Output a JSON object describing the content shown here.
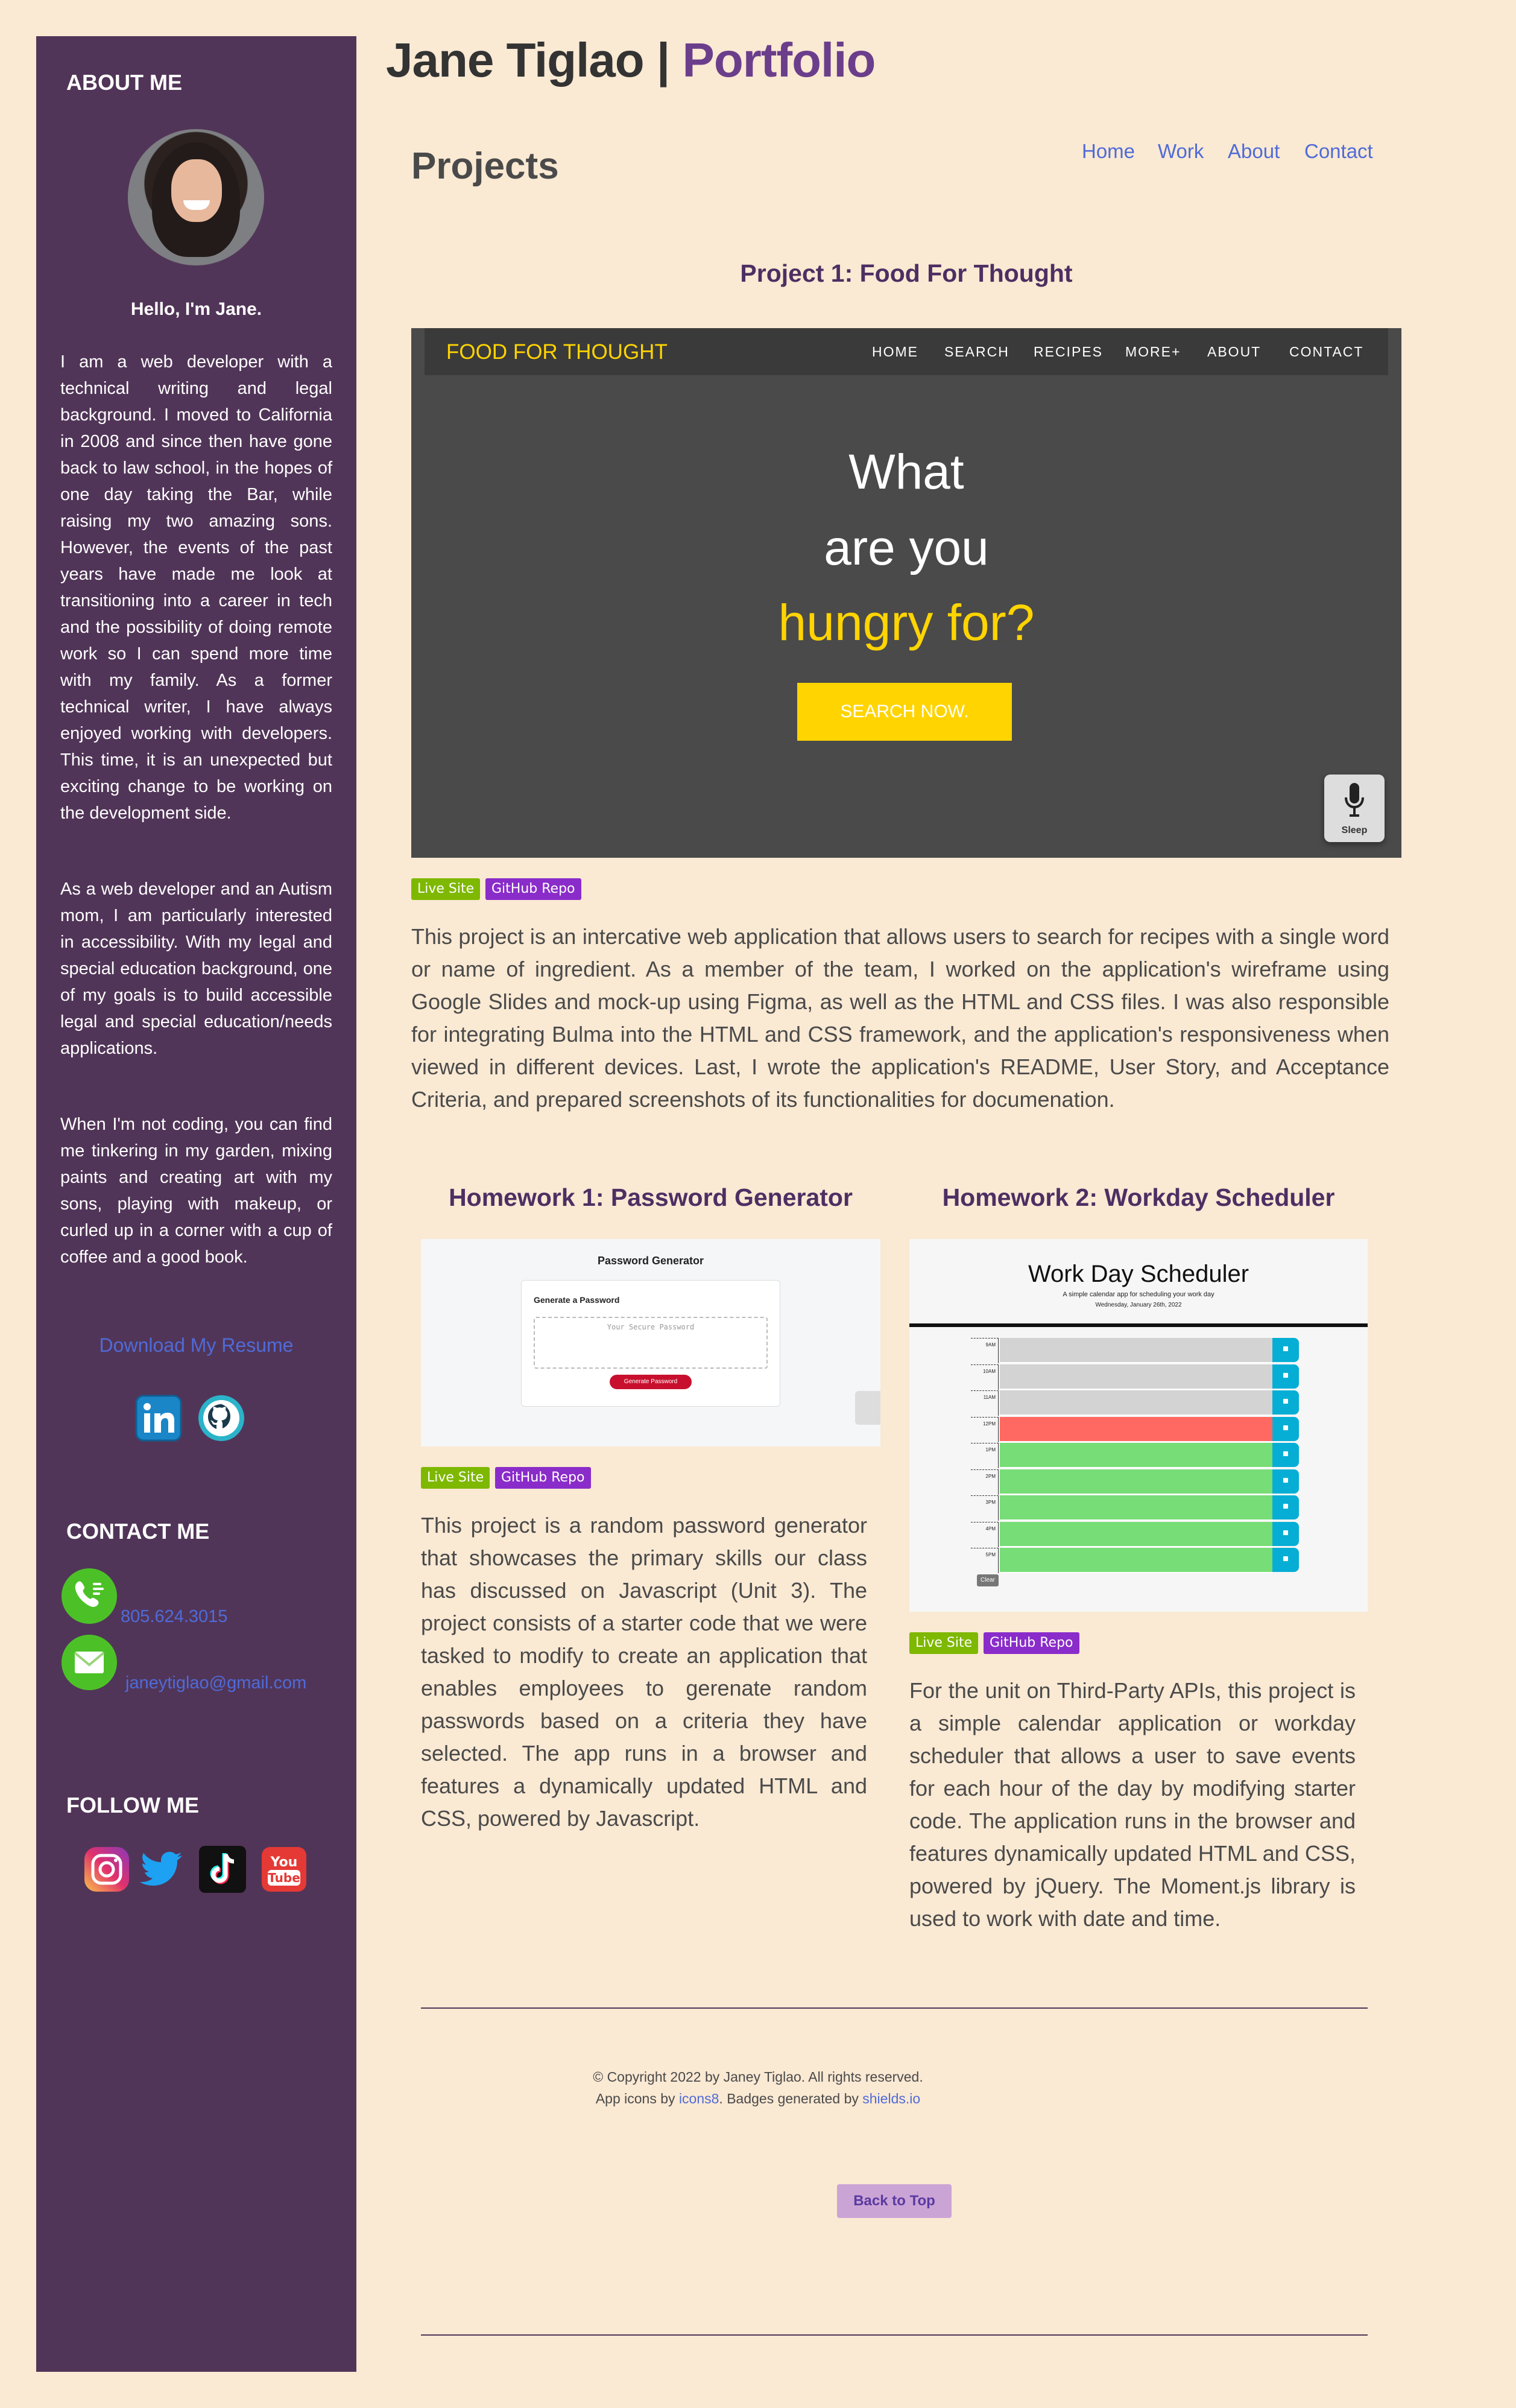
{
  "header": {
    "title_name": "Jane Tiglao | ",
    "title_accent": "Portfolio"
  },
  "nav": [
    "Home",
    "Work",
    "About",
    "Contact"
  ],
  "sidebar": {
    "about_heading": "ABOUT ME",
    "greeting": "Hello, I'm Jane.",
    "bio": [
      "I am a web developer with a technical writing and legal background. I moved to California in 2008 and since then have gone back to law school, in the hopes of one day taking the Bar, while raising my two amazing sons. However, the events of the past years have made me look at transitioning into a career in tech and the possibility of doing remote work so I can spend more time with my family. As a former technical writer, I have always enjoyed working with developers. This time, it is an unexpected but exciting change to be working on the development side.",
      "As a web developer and an Autism mom, I am particularly interested in accessibility. With my legal and special education background, one of my goals is to build accessible legal and special education/needs applications.",
      "When I'm not coding, you can find me tinkering in my garden, mixing paints and creating art with my sons, playing with makeup, or curled up in a corner with a cup of coffee and a good book."
    ],
    "resume_link": "Download My Resume",
    "contact_heading": "CONTACT ME",
    "phone": "805.624.3015",
    "email": "janeytiglao@gmail.com",
    "follow_heading": "FOLLOW ME"
  },
  "main": {
    "section_title": "Projects",
    "project1": {
      "title": "Project 1: Food For Thought",
      "screenshot": {
        "brand": "FOOD FOR THOUGHT",
        "menu": [
          "HOME",
          "SEARCH",
          "RECIPES",
          "MORE+",
          "ABOUT",
          "CONTACT"
        ],
        "line1": "What",
        "line2": "are you",
        "line3": "hungry for?",
        "cta": "SEARCH NOW.",
        "mic_label": "Sleep"
      },
      "description": "This project is an intercative web application that allows users to search for recipes with a single word or name of ingredient. As a member of the team, I worked on the application's wireframe using Google Slides and mock-up using Figma, as well as the HTML and CSS files. I was also responsible for integrating Bulma into the HTML and CSS framework, and the application's responsiveness when viewed in different devices. Last, I wrote the application's README, User Story, and Acceptance Criteria, and prepared screenshots of its functionalities for documenation."
    },
    "homework1": {
      "title": "Homework 1: Password Generator",
      "screenshot": {
        "heading": "Password Generator",
        "card_title": "Generate a Password",
        "placeholder": "Your Secure Password",
        "button": "Generate Password"
      },
      "description": "This project is a random password generator that showcases the primary skills our class has discussed on Javascript (Unit 3). The project consists of a starter code that we were tasked to modify to create an application that enables employees to gerenate random passwords based on a criteria they have selected. The app runs in a browser and features a dynamically updated HTML and CSS, powered by Javascript."
    },
    "homework2": {
      "title": "Homework 2: Workday Scheduler",
      "screenshot": {
        "heading": "Work Day Scheduler",
        "tagline": "A simple calendar app for scheduling your work day",
        "date": "Wednesday, January 26th, 2022",
        "hours": [
          "9AM",
          "10AM",
          "11AM",
          "12PM",
          "1PM",
          "2PM",
          "3PM",
          "4PM",
          "5PM"
        ],
        "clear": "Clear"
      },
      "description": "For the unit on Third-Party APIs, this project is a simple calendar application or workday scheduler that allows a user to save events for each hour of the day by modifying starter code. The application runs in the browser and features dynamically updated HTML and CSS, powered by jQuery. The Moment.js library is used to work with date and time."
    },
    "badges": {
      "live": "Live Site",
      "repo": "GitHub Repo"
    }
  },
  "footer": {
    "copyright": "© Copyright 2022 by Janey Tiglao. All rights reserved.",
    "icons_prefix": "App icons by ",
    "icons_link": "icons8",
    "badges_mid": ". Badges generated by ",
    "badges_link": "shields.io",
    "back_to_top": "Back to Top"
  },
  "colors": {
    "background": "#fae9d3",
    "sidebar": "#513558",
    "accent": "#6b3e8b",
    "link": "#4f6bd8"
  }
}
